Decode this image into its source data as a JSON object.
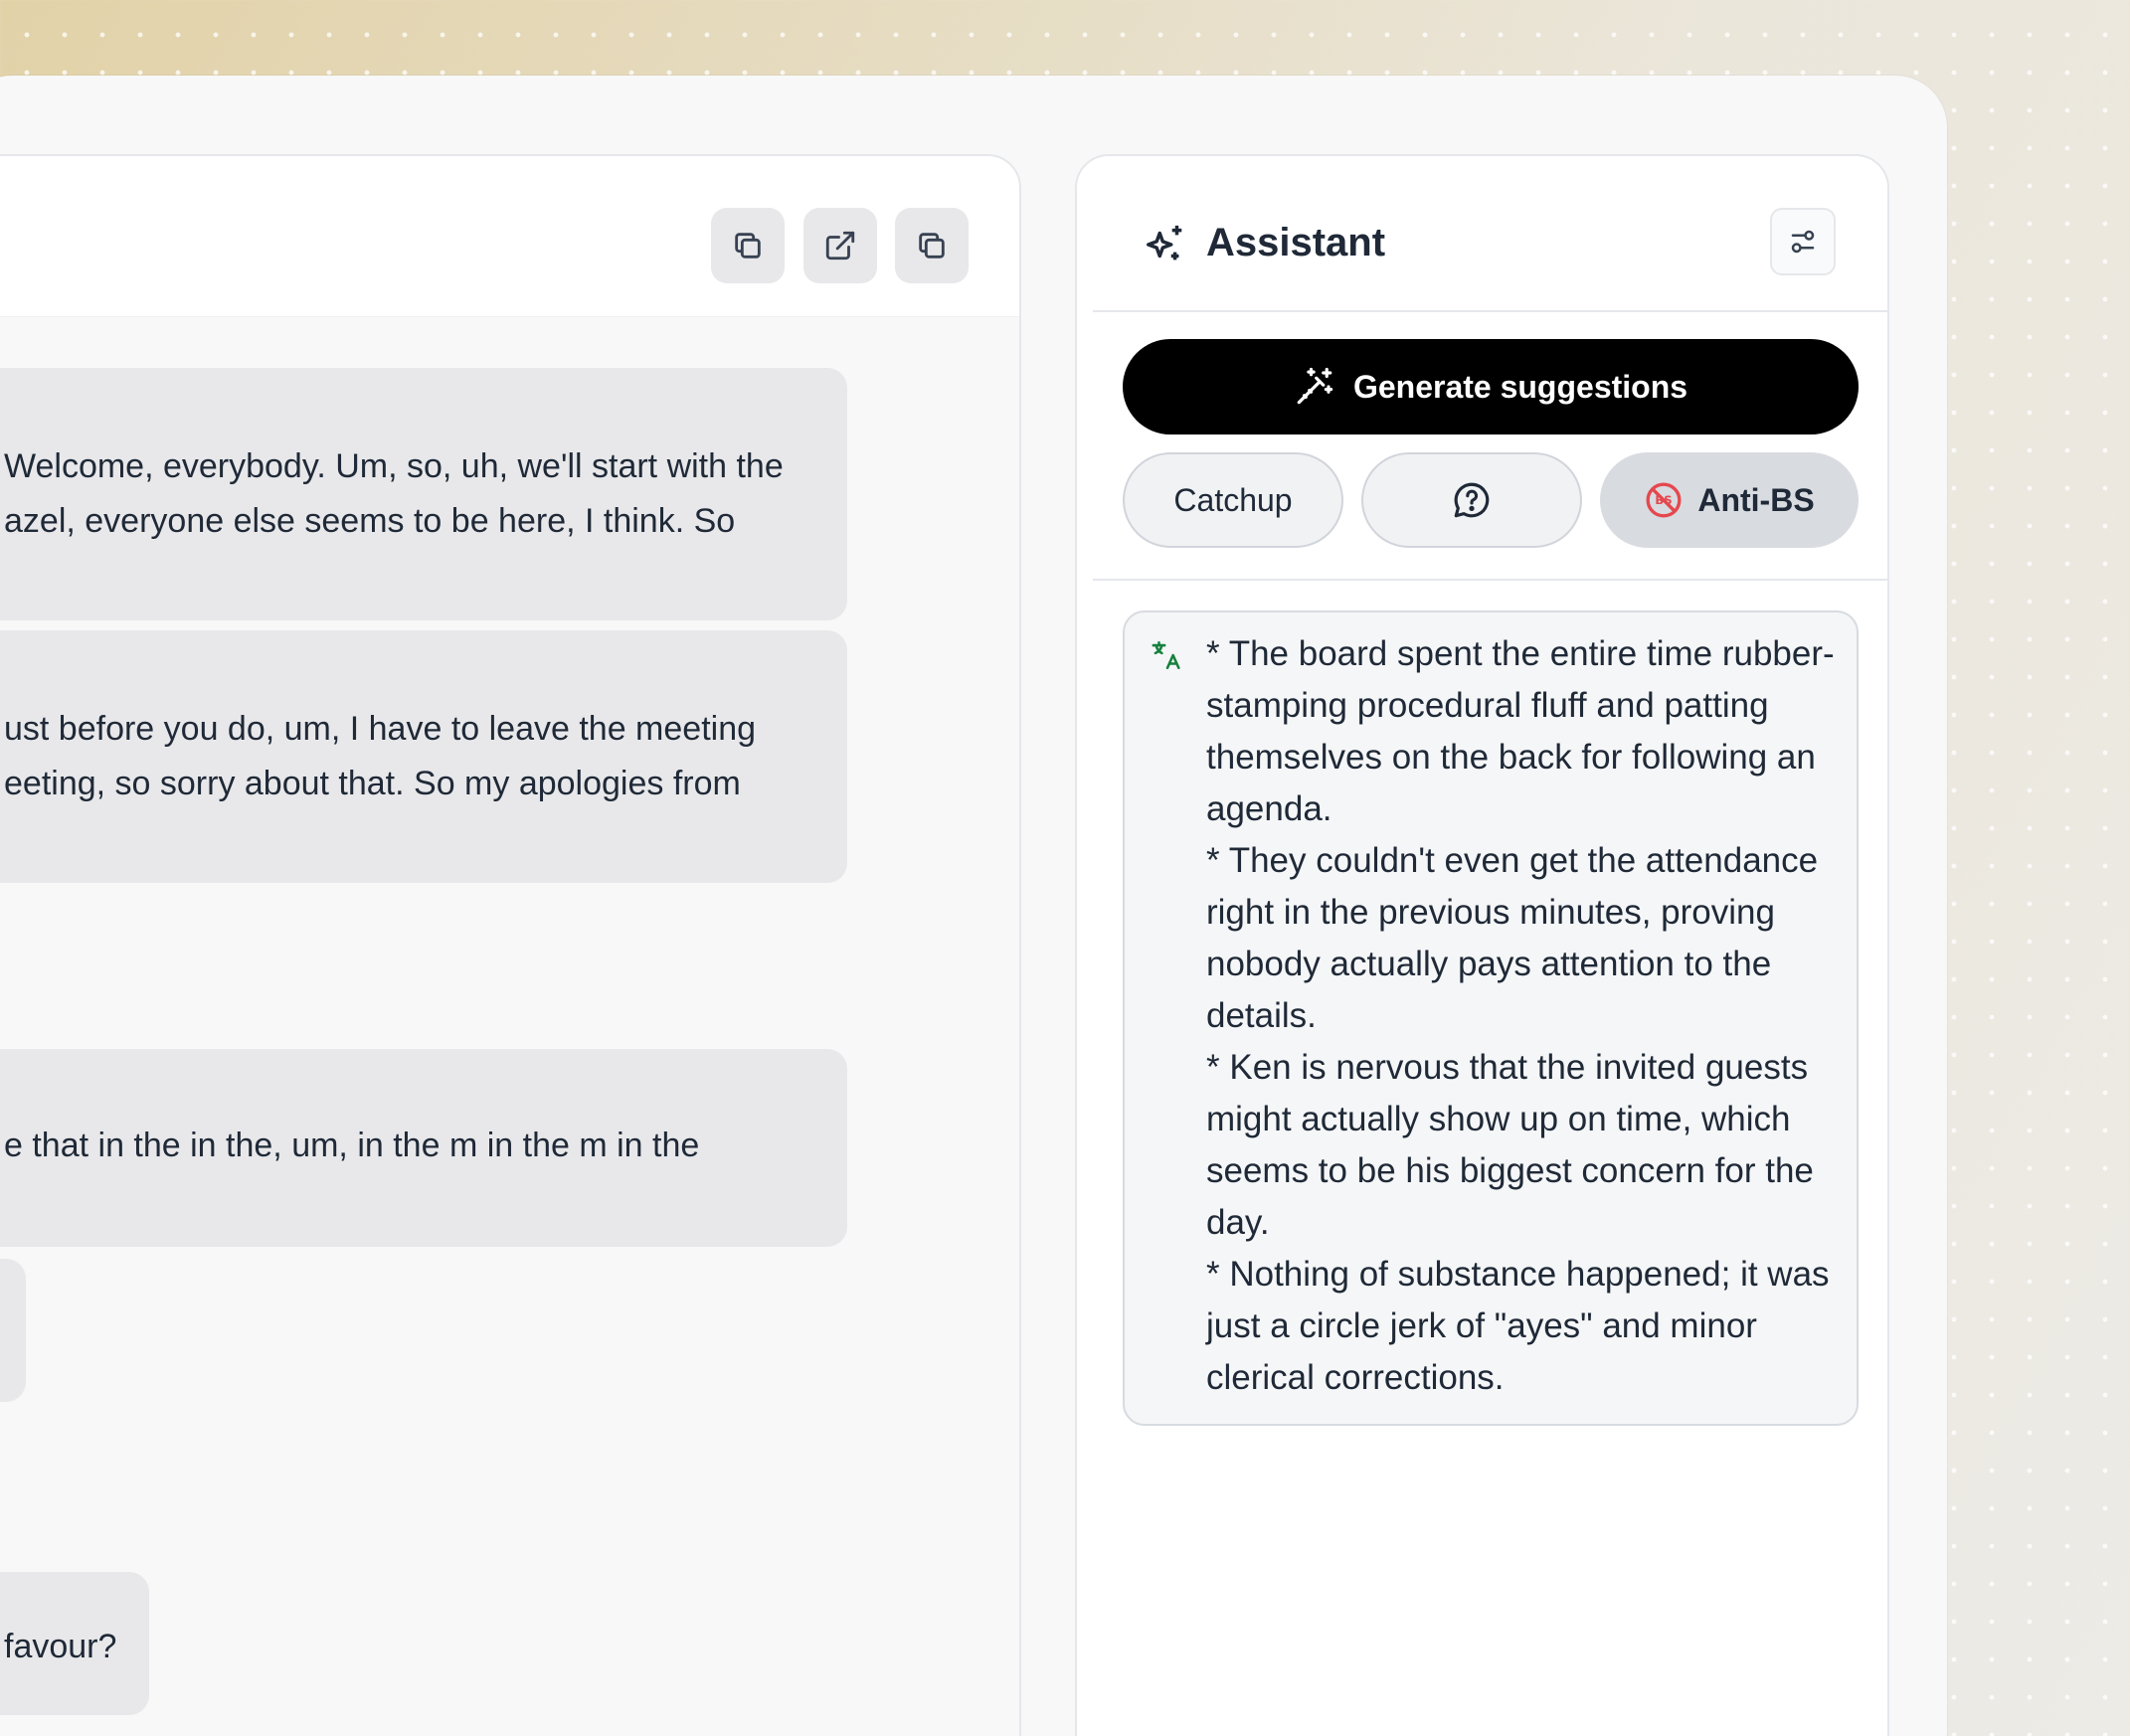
{
  "transcript": {
    "toolbar": {
      "copy_icon": "copy-icon",
      "open_external_icon": "external-link-icon",
      "duplicate_icon": "copy-icon"
    },
    "messages": [
      {
        "lines": [
          "Welcome, everybody. Um, so, uh, we'll start with the",
          "azel, everyone else seems to be here, I think. So"
        ]
      },
      {
        "lines": [
          "ust before you do, um, I have to leave the meeting",
          "eeting, so sorry about that. So my apologies from"
        ]
      },
      {
        "lines": [
          "e that in the in the, um, in the m in the m in the"
        ]
      },
      {
        "lines": []
      },
      {
        "lines": [
          "favour?"
        ]
      }
    ]
  },
  "assistant": {
    "title": "Assistant",
    "title_icon": "sparkles-icon",
    "settings_icon": "sliders-icon",
    "generate_label": "Generate suggestions",
    "generate_icon": "magic-wand-icon",
    "actions": [
      {
        "label": "Catchup",
        "icon": "",
        "active": false
      },
      {
        "label": "",
        "icon": "question-bubble-icon",
        "active": false
      },
      {
        "label": "Anti-BS",
        "icon": "no-bs-icon",
        "active": true
      }
    ],
    "result_icon": "translate-icon",
    "result_items": [
      "* The board spent the entire time rubber-stamping procedural fluff and patting themselves on the back for following an agenda.",
      "* They couldn't even get the attendance right in the previous minutes, proving nobody actually pays attention to the details.",
      "* Ken is nervous that the invited guests might actually show up on time, which seems to be his biggest concern for the day.",
      "* Nothing of substance happened; it was just a circle jerk of \"ayes\" and minor clerical corrections."
    ],
    "colors": {
      "accent": "#000000",
      "anti_bs_red": "#e5484d",
      "translate_green": "#15803d"
    }
  }
}
